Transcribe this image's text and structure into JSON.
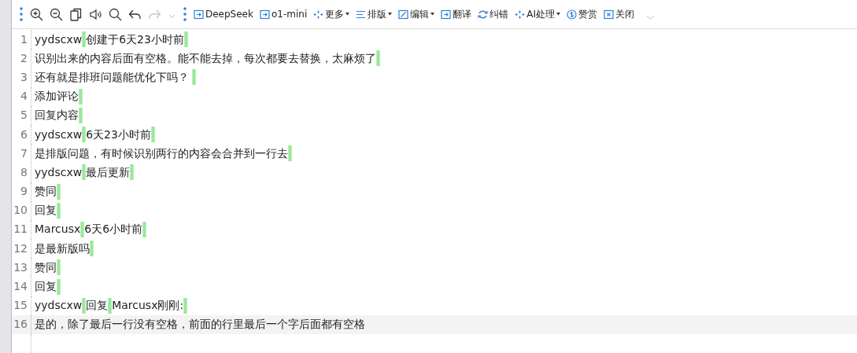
{
  "toolbar": {
    "icon_buttons": [
      {
        "kind": "zoom-in",
        "disabled": false
      },
      {
        "kind": "zoom-out",
        "disabled": false
      },
      {
        "kind": "copy",
        "disabled": false
      },
      {
        "kind": "speaker",
        "disabled": false
      },
      {
        "kind": "search",
        "disabled": false
      },
      {
        "kind": "undo",
        "disabled": false
      },
      {
        "kind": "redo",
        "disabled": true
      }
    ],
    "actions": [
      {
        "label": "DeepSeek",
        "kind": "model",
        "dropdown": false
      },
      {
        "label": "o1-mini",
        "kind": "model",
        "dropdown": false
      },
      {
        "label": "更多",
        "kind": "sparkle",
        "dropdown": true
      },
      {
        "label": "排版",
        "kind": "lines",
        "dropdown": true
      },
      {
        "label": "编辑",
        "kind": "edit",
        "dropdown": true
      },
      {
        "label": "翻译",
        "kind": "model",
        "dropdown": false
      },
      {
        "label": "纠错",
        "kind": "refresh",
        "dropdown": false
      },
      {
        "label": "AI处理",
        "kind": "sparkle",
        "dropdown": true
      },
      {
        "label": "赞赏",
        "kind": "coin",
        "dropdown": false
      },
      {
        "label": "关闭",
        "kind": "close",
        "dropdown": false
      }
    ]
  },
  "editor": {
    "lines": [
      {
        "number": "1",
        "parts": [
          "yydscxw",
          "创建于6天23小时前"
        ],
        "trailing_mark": true,
        "current": false
      },
      {
        "number": "2",
        "parts": [
          "识别出来的内容后面有空格。能不能去掉，每次都要去替换，太麻烦了"
        ],
        "trailing_mark": true,
        "current": false
      },
      {
        "number": "3",
        "parts": [
          "还有就是排班问题能优化下吗？ "
        ],
        "trailing_mark": true,
        "current": false
      },
      {
        "number": "4",
        "parts": [
          "添加评论"
        ],
        "trailing_mark": true,
        "current": false
      },
      {
        "number": "5",
        "parts": [
          "回复内容"
        ],
        "trailing_mark": true,
        "current": false
      },
      {
        "number": "6",
        "parts": [
          "yydscxw",
          "6天23小时前"
        ],
        "trailing_mark": true,
        "current": false
      },
      {
        "number": "7",
        "parts": [
          "是排版问题，有时候识别两行的内容会合并到一行去"
        ],
        "trailing_mark": true,
        "current": false
      },
      {
        "number": "8",
        "parts": [
          "yydscxw",
          "最后更新"
        ],
        "trailing_mark": true,
        "current": false
      },
      {
        "number": "9",
        "parts": [
          "赞同"
        ],
        "trailing_mark": true,
        "current": false
      },
      {
        "number": "10",
        "parts": [
          "回复"
        ],
        "trailing_mark": true,
        "current": false
      },
      {
        "number": "11",
        "parts": [
          "Marcusx",
          "6天6小时前"
        ],
        "trailing_mark": true,
        "current": false
      },
      {
        "number": "12",
        "parts": [
          "是最新版吗"
        ],
        "trailing_mark": true,
        "current": false
      },
      {
        "number": "13",
        "parts": [
          "赞同"
        ],
        "trailing_mark": true,
        "current": false
      },
      {
        "number": "14",
        "parts": [
          "回复"
        ],
        "trailing_mark": true,
        "current": false
      },
      {
        "number": "15",
        "parts": [
          "yydscxw",
          "回复",
          "Marcusx刚刚:"
        ],
        "trailing_mark": true,
        "current": false
      },
      {
        "number": "16",
        "parts": [
          "是的，除了最后一行没有空格，前面的行里最后一个字后面都有空格"
        ],
        "trailing_mark": false,
        "current": true
      }
    ]
  }
}
